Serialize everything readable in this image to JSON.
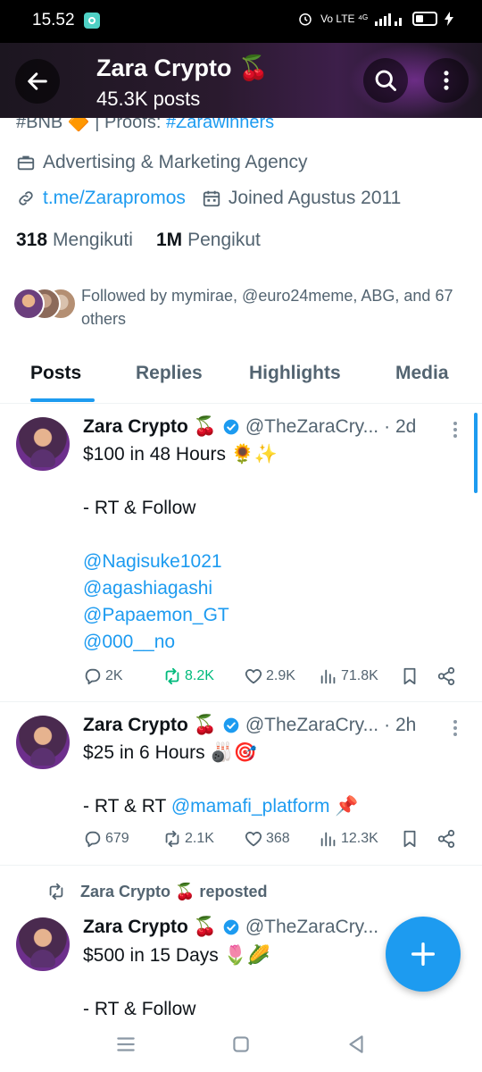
{
  "status_bar": {
    "time": "15.52",
    "network": "Vo LTE ⁴ᴳ"
  },
  "header": {
    "name": "Zara Crypto 🍒",
    "posts_count": "45.3K posts"
  },
  "profile": {
    "bio_partial": "#BNB 🔶 | Proofs: ",
    "bio_partial_tag": "#Zarawinners",
    "category": "Advertising & Marketing Agency",
    "link": "t.me/Zarapromos",
    "joined": "Joined Agustus 2011",
    "following_count": "318",
    "following_label": "Mengikuti",
    "followers_count": "1M",
    "followers_label": "Pengikut",
    "followed_by": "Followed by mymirae, @euro24meme, ABG, and 67 others"
  },
  "tabs": [
    {
      "label": "Posts",
      "active": true
    },
    {
      "label": "Replies",
      "active": false
    },
    {
      "label": "Highlights",
      "active": false
    },
    {
      "label": "Media",
      "active": false
    }
  ],
  "posts": [
    {
      "name": "Zara Crypto 🍒",
      "handle": "@TheZaraCry...",
      "time": "· 2d",
      "lines": [
        "$100 in 48 Hours 🌻✨",
        "",
        "- RT & Follow",
        ""
      ],
      "mentions": [
        "@Nagisuke1021",
        "@agashiagashi",
        "@Papaemon_GT",
        "@000__no"
      ],
      "replies": "2K",
      "reposts": "8.2K",
      "likes": "2.9K",
      "views": "71.8K"
    },
    {
      "name": "Zara Crypto 🍒",
      "handle": "@TheZaraCry...",
      "time": "· 2h",
      "lines": [
        "$25 in 6 Hours 🎳🎯",
        ""
      ],
      "rt_prefix": "- RT & RT ",
      "rt_mention": "@mamafi_platform",
      "rt_suffix": " 📌",
      "replies": "679",
      "reposts": "2.1K",
      "likes": "368",
      "views": "12.3K"
    },
    {
      "repost_label": "Zara Crypto 🍒 reposted",
      "name": "Zara Crypto 🍒",
      "handle": "@TheZaraCry...",
      "lines": [
        "$500 in 15 Days 🌷🌽",
        "",
        "- RT & Follow"
      ]
    }
  ],
  "colors": {
    "accent": "#1d9bf0",
    "repost_active": "#00ba7c",
    "muted": "#536471"
  }
}
